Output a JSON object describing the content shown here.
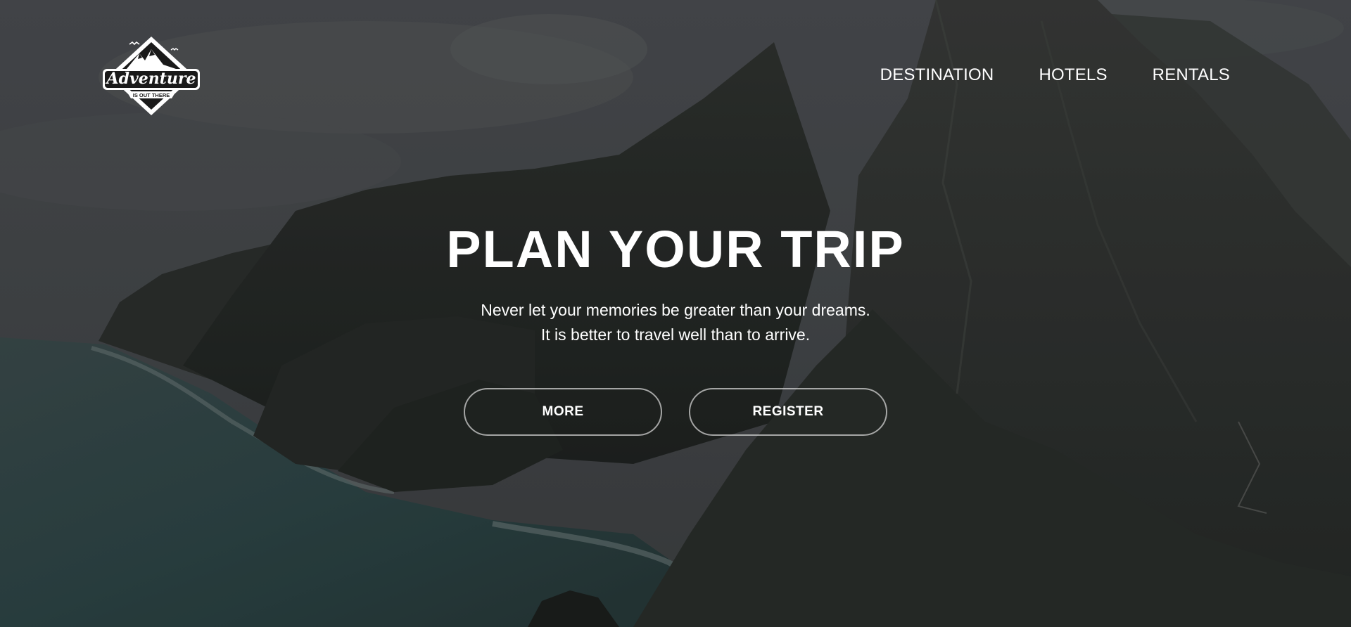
{
  "brand": {
    "logo_main": "Adventure",
    "logo_sub": "IS OUT THERE"
  },
  "nav": {
    "items": [
      {
        "label": "DESTINATION"
      },
      {
        "label": "HOTELS"
      },
      {
        "label": "RENTALS"
      }
    ]
  },
  "hero": {
    "title": "PLAN YOUR TRIP",
    "tagline_line1": "Never let your memories be greater than your dreams.",
    "tagline_line2": "It is better to travel well than to arrive.",
    "more_label": "MORE",
    "register_label": "REGISTER"
  },
  "colors": {
    "text": "#ffffff",
    "overlay": "#2e3133",
    "button_border": "#d2d2d2",
    "sea": "#2f4a4c"
  },
  "icons": {
    "logo": "adventure-mountain-badge-icon"
  }
}
